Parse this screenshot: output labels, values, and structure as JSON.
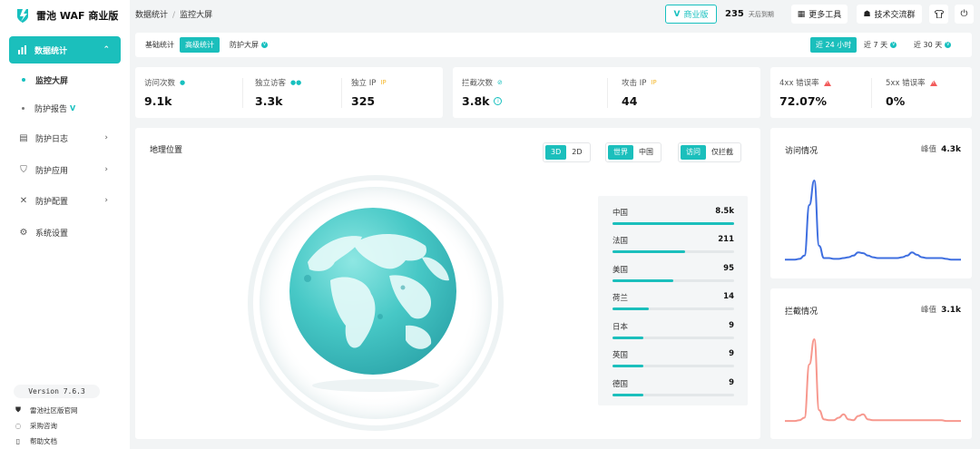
{
  "app": {
    "name": "雷池 WAF 商业版"
  },
  "sidebar": {
    "active": {
      "label": "数据统计"
    },
    "subs": [
      {
        "label": "监控大屏"
      },
      {
        "label": "防护报告"
      }
    ],
    "items": [
      {
        "label": "防护日志",
        "icon": "log-icon"
      },
      {
        "label": "防护应用",
        "icon": "shield-icon"
      },
      {
        "label": "防护配置",
        "icon": "tools-icon"
      },
      {
        "label": "系统设置",
        "icon": "gear-icon"
      }
    ],
    "version": "Version 7.6.3",
    "footer_links": [
      {
        "label": "雷池社区版官网",
        "icon": "shield-small-icon"
      },
      {
        "label": "采购咨询",
        "icon": "chat-icon"
      },
      {
        "label": "帮助文档",
        "icon": "doc-icon"
      }
    ]
  },
  "header": {
    "breadcrumb": [
      "数据统计",
      "监控大屏"
    ],
    "edition": "商业版",
    "days_num": "235",
    "days_unit": "天后到期",
    "more_tools": "更多工具",
    "community": "技术交流群"
  },
  "tabs": {
    "left": [
      {
        "label": "基础统计"
      },
      {
        "label": "高级统计"
      },
      {
        "label": "防护大屏"
      }
    ],
    "right": [
      {
        "label": "近 24 小时"
      },
      {
        "label": "近 7 天"
      },
      {
        "label": "近 30 天"
      }
    ]
  },
  "stats": {
    "visits": {
      "label": "访问次数",
      "value": "9.1k"
    },
    "uv": {
      "label": "独立访客",
      "value": "3.3k"
    },
    "ip": {
      "label": "独立 IP",
      "value": "325"
    },
    "blocked": {
      "label": "拦截次数",
      "value": "3.8k"
    },
    "attack_ip": {
      "label": "攻击 IP",
      "value": "44"
    },
    "err4": {
      "label": "4xx 错误率",
      "value": "72.07%"
    },
    "err5": {
      "label": "5xx 错误率",
      "value": "0%"
    }
  },
  "geo": {
    "title": "地理位置",
    "view_options": [
      "3D",
      "2D"
    ],
    "region_options": [
      "世界",
      "中国"
    ],
    "filter_options": [
      "访问",
      "仅拦截"
    ],
    "ranking": [
      {
        "name": "中国",
        "count": "8.5k",
        "share": 1.0
      },
      {
        "name": "法国",
        "count": "211",
        "share": 0.6
      },
      {
        "name": "美国",
        "count": "95",
        "share": 0.5
      },
      {
        "name": "荷兰",
        "count": "14",
        "share": 0.3
      },
      {
        "name": "日本",
        "count": "9",
        "share": 0.25
      },
      {
        "name": "英国",
        "count": "9",
        "share": 0.25
      },
      {
        "name": "德国",
        "count": "9",
        "share": 0.25
      }
    ]
  },
  "charts": {
    "visits": {
      "title": "访问情况",
      "peak_label": "峰值",
      "peak": "4.3k",
      "color": "#3f6fe0",
      "values": [
        3,
        3,
        3,
        4,
        8,
        70,
        100,
        20,
        5,
        5,
        4,
        4,
        5,
        6,
        8,
        12,
        11,
        8,
        6,
        5,
        5,
        5,
        5,
        5,
        6,
        8,
        12,
        9,
        6,
        5,
        5,
        5,
        5,
        4,
        3,
        3,
        3
      ]
    },
    "blocked": {
      "title": "拦截情况",
      "peak_label": "峰值",
      "peak": "3.1k",
      "color": "#f7988e",
      "values": [
        2,
        2,
        2,
        3,
        6,
        70,
        100,
        15,
        4,
        3,
        3,
        6,
        10,
        4,
        3,
        8,
        10,
        4,
        3,
        3,
        3,
        3,
        3,
        3,
        3,
        3,
        3,
        3,
        3,
        3,
        3,
        3,
        3,
        2,
        2,
        2,
        2
      ]
    }
  }
}
